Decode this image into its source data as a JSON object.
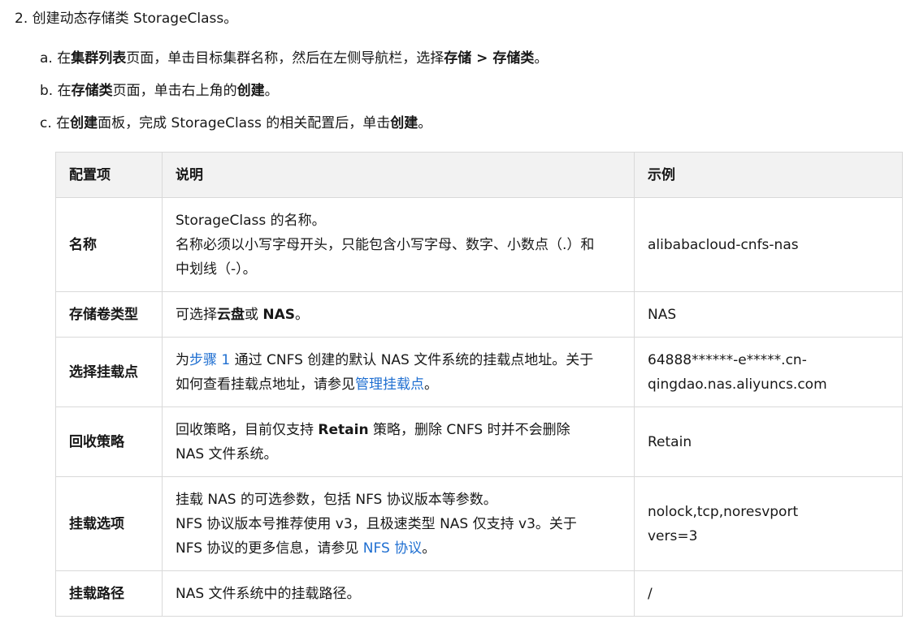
{
  "step": {
    "title": "2. 创建动态存储类 StorageClass。"
  },
  "substeps": {
    "a": {
      "prefix": "a. 在",
      "b1": "集群列表",
      "mid1": "页面，单击目标集群名称，然后在左侧导航栏，选择",
      "b2": "存储 > 存储类",
      "suffix": "。"
    },
    "b": {
      "prefix": "b. 在",
      "b1": "存储类",
      "mid1": "页面，单击右上角的",
      "b2": "创建",
      "suffix": "。"
    },
    "c": {
      "prefix": "c. 在",
      "b1": "创建",
      "mid1": "面板，完成 StorageClass 的相关配置后，单击",
      "b2": "创建",
      "suffix": "。"
    }
  },
  "table": {
    "headers": [
      "配置项",
      "说明",
      "示例"
    ],
    "rows": {
      "name": {
        "key": "名称",
        "desc_line1": "StorageClass 的名称。",
        "desc_line2": "名称必须以小写字母开头，只能包含小写字母、数字、小数点（.）和",
        "desc_line3": "中划线（-）。",
        "example": "alibabacloud-cnfs-nas"
      },
      "volume_type": {
        "key": "存储卷类型",
        "desc_prefix": "可选择",
        "desc_b1": "云盘",
        "desc_mid": "或 ",
        "desc_b2": "NAS",
        "desc_suffix": "。",
        "example": "NAS"
      },
      "mount_point": {
        "key": "选择挂载点",
        "desc_prefix": "为",
        "desc_link1": "步骤 1",
        "desc_mid1": " 通过 CNFS 创建的默认 NAS 文件系统的挂载点地址。关于",
        "desc_mid2": "如何查看挂载点地址，请参见",
        "desc_link2": "管理挂载点",
        "desc_suffix": "。",
        "example_line1": "64888******-e*****.cn-",
        "example_line2": "qingdao.nas.aliyuncs.com"
      },
      "reclaim": {
        "key": "回收策略",
        "desc_prefix": "回收策略，目前仅支持 ",
        "desc_b1": "Retain",
        "desc_mid": " 策略，删除 CNFS 时并不会删除",
        "desc_line2": "NAS 文件系统。",
        "example": "Retain"
      },
      "mount_options": {
        "key": "挂载选项",
        "desc_line1": "挂载 NAS 的可选参数，包括 NFS 协议版本等参数。",
        "desc_line2": "NFS 协议版本号推荐使用 v3，且极速类型 NAS 仅支持 v3。关于",
        "desc_line3_prefix": "NFS 协议的更多信息，请参见 ",
        "desc_link": "NFS 协议",
        "desc_suffix": "。",
        "example_line1": "nolock,tcp,noresvport",
        "example_line2": "vers=3"
      },
      "mount_path": {
        "key": "挂载路径",
        "desc": "NAS 文件系统中的挂载路径。",
        "example": "/"
      }
    }
  },
  "colors": {
    "link": "#1f6fd1",
    "header_bg": "#f2f2f2",
    "border": "#d9d9d9"
  }
}
